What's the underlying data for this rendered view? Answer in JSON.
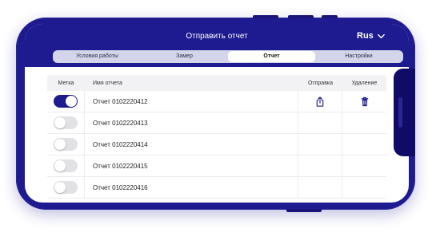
{
  "header": {
    "title": "Отправить отчет",
    "language": "Rus"
  },
  "tabs": [
    {
      "label": "Условия работы",
      "active": false
    },
    {
      "label": "Замер",
      "active": false
    },
    {
      "label": "Отчет",
      "active": true
    },
    {
      "label": "Настройки",
      "active": false
    }
  ],
  "table": {
    "columns": {
      "mark": "Метка",
      "name": "Имя отчета",
      "send": "Отправка",
      "delete": "Удаление"
    },
    "rows": [
      {
        "name": "Отчет 0102220412",
        "marked": true,
        "has_actions": true
      },
      {
        "name": "Отчет 0102220413",
        "marked": false,
        "has_actions": false
      },
      {
        "name": "Отчет 0102220414",
        "marked": false,
        "has_actions": false
      },
      {
        "name": "Отчет 0102220415",
        "marked": false,
        "has_actions": false
      },
      {
        "name": "Отчет 0102220416",
        "marked": false,
        "has_actions": false
      }
    ]
  },
  "icons": {
    "language_dropdown": "chevron-down-icon",
    "send": "share-upload-icon",
    "delete": "trash-icon"
  },
  "colors": {
    "accent": "#1e1a8f",
    "toggle_off": "#e1e1e6",
    "header_row": "#f2f2f5"
  }
}
